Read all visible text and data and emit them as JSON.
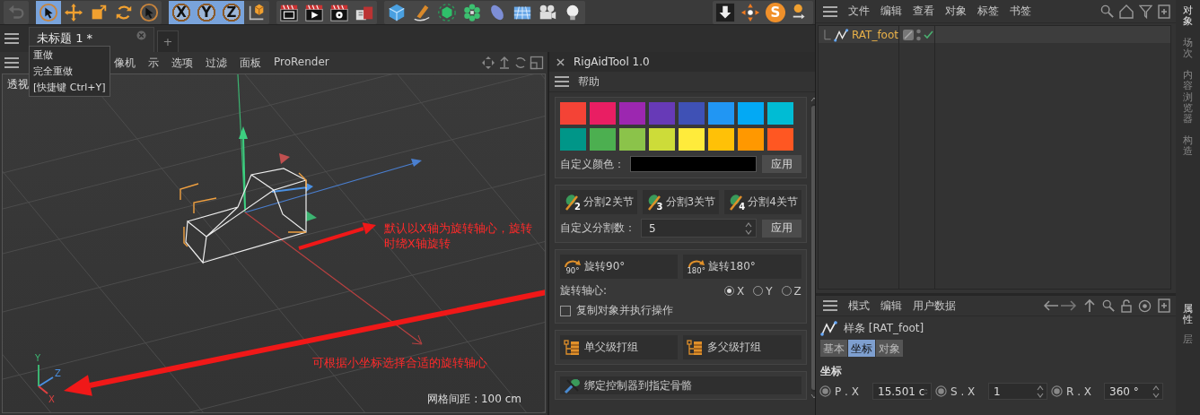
{
  "toolbar": {
    "groups": [
      [
        {
          "kind": "undo",
          "selected": false
        }
      ],
      [
        {
          "kind": "select",
          "selected": true
        },
        {
          "kind": "move",
          "selected": false
        },
        {
          "kind": "scale",
          "selected": false
        },
        {
          "kind": "rotate",
          "selected": false
        },
        {
          "kind": "select",
          "selected": false
        }
      ],
      [
        {
          "kind": "axis",
          "label": "X",
          "selected": true
        },
        {
          "kind": "axis",
          "label": "Y",
          "selected": true
        },
        {
          "kind": "axis",
          "label": "Z",
          "selected": true
        },
        {
          "kind": "coords",
          "selected": false
        }
      ],
      [
        {
          "kind": "render-view",
          "selected": false
        },
        {
          "kind": "render",
          "selected": false
        },
        {
          "kind": "render-settings",
          "selected": false
        },
        {
          "kind": "render-queue",
          "selected": false
        }
      ],
      [
        {
          "kind": "cube",
          "selected": false
        },
        {
          "kind": "pen",
          "selected": false
        },
        {
          "kind": "subdivide",
          "selected": false
        },
        {
          "kind": "cloner",
          "selected": false
        },
        {
          "kind": "deformer",
          "selected": false
        },
        {
          "kind": "floor",
          "selected": false
        },
        {
          "kind": "camera",
          "selected": false
        },
        {
          "kind": "light",
          "selected": false
        }
      ]
    ],
    "right": [
      {
        "kind": "download",
        "selected": false
      },
      {
        "kind": "target",
        "selected": false
      },
      {
        "kind": "badge",
        "label": "S",
        "selected": false
      },
      {
        "kind": "xyz",
        "selected": false
      }
    ]
  },
  "document_tabs": [
    {
      "label": "未标题 1 *",
      "selected": true
    }
  ],
  "new_tab": "+",
  "tooltip": {
    "lines": [
      "重做",
      "完全重做",
      "[快捷键 Ctrl+Y]"
    ]
  },
  "viewport": {
    "menu": [
      "像机",
      "示",
      "选项",
      "过滤",
      "面板",
      "ProRender"
    ],
    "label": "透视",
    "annotations": [
      "默认以X轴为旋转轴心，旋转",
      "时绕X轴旋转",
      "可根据小坐标选择合适的旋转轴心"
    ],
    "axis_indicator": [
      {
        "label": "Y",
        "color": "#3cb371"
      },
      {
        "label": "Z",
        "color": "#4a90e2"
      },
      {
        "label": "X",
        "color": "#e04040"
      }
    ],
    "grid_spacing": "网格间距 : 100 cm"
  },
  "rig_panel": {
    "title": "RigAidTool 1.0",
    "menu": [
      "帮助"
    ],
    "swatches": [
      {
        "color": "#f44336"
      },
      {
        "color": "#e91e63"
      },
      {
        "color": "#9c27b0"
      },
      {
        "color": "#673ab7"
      },
      {
        "color": "#3f51b5"
      },
      {
        "color": "#2196f3"
      },
      {
        "color": "#03a9f4"
      },
      {
        "color": "#00bcd4"
      },
      {
        "color": "#009688"
      },
      {
        "color": "#4caf50"
      },
      {
        "color": "#8bc34a"
      },
      {
        "color": "#cddc39"
      },
      {
        "color": "#ffeb3b"
      },
      {
        "color": "#ffc107"
      },
      {
        "color": "#ff9800"
      },
      {
        "color": "#ff5722"
      }
    ],
    "custom_color": {
      "label": "自定义颜色：",
      "color": "#000000",
      "button": "应用"
    },
    "split_buttons": [
      {
        "badge": "2",
        "label": "分割2关节"
      },
      {
        "badge": "3",
        "label": "分割3关节"
      },
      {
        "badge": "4",
        "label": "分割4关节"
      }
    ],
    "custom_split": {
      "label": "自定义分割数：",
      "value": "5",
      "button": "应用"
    },
    "rotate_buttons": [
      {
        "badge": "90°",
        "label": "旋转90°"
      },
      {
        "badge": "180°",
        "label": "旋转180°"
      }
    ],
    "axis": {
      "label": "旋转轴心:",
      "options": [
        {
          "label": "X",
          "selected": true
        },
        {
          "label": "Y",
          "selected": false
        },
        {
          "label": "Z",
          "selected": false
        }
      ]
    },
    "copy_checkbox": {
      "label": "复制对象并执行操作",
      "checked": false
    },
    "group_buttons": [
      "单父级打组",
      "多父级打组"
    ],
    "bind_button": "绑定控制器到指定骨骼"
  },
  "object_manager": {
    "menu": [
      "文件",
      "编辑",
      "查看",
      "对象",
      "标签",
      "书签"
    ],
    "objects": [
      {
        "name": "RAT_foot",
        "selected": true
      }
    ]
  },
  "side_tabs_top": [
    {
      "label": "对象",
      "selected": true
    },
    {
      "label": "场次",
      "selected": false
    },
    {
      "label": "内容浏览器",
      "selected": false
    },
    {
      "label": "构造",
      "selected": false
    }
  ],
  "attribute_manager": {
    "menu": [
      "模式",
      "编辑",
      "用户数据"
    ],
    "title": "样条 [RAT_foot]",
    "tabs": [
      {
        "label": "基本",
        "selected": false
      },
      {
        "label": "坐标",
        "selected": true
      },
      {
        "label": "对象",
        "selected": false
      }
    ],
    "section": "坐标",
    "fields": [
      {
        "label": "P . X",
        "value": "15.501 c"
      },
      {
        "label": "S . X",
        "value": "1"
      },
      {
        "label": "R . X",
        "value": "360 °"
      }
    ]
  },
  "side_tabs_bottom": [
    {
      "label": "属性",
      "selected": true
    },
    {
      "label": "层",
      "selected": false
    }
  ]
}
